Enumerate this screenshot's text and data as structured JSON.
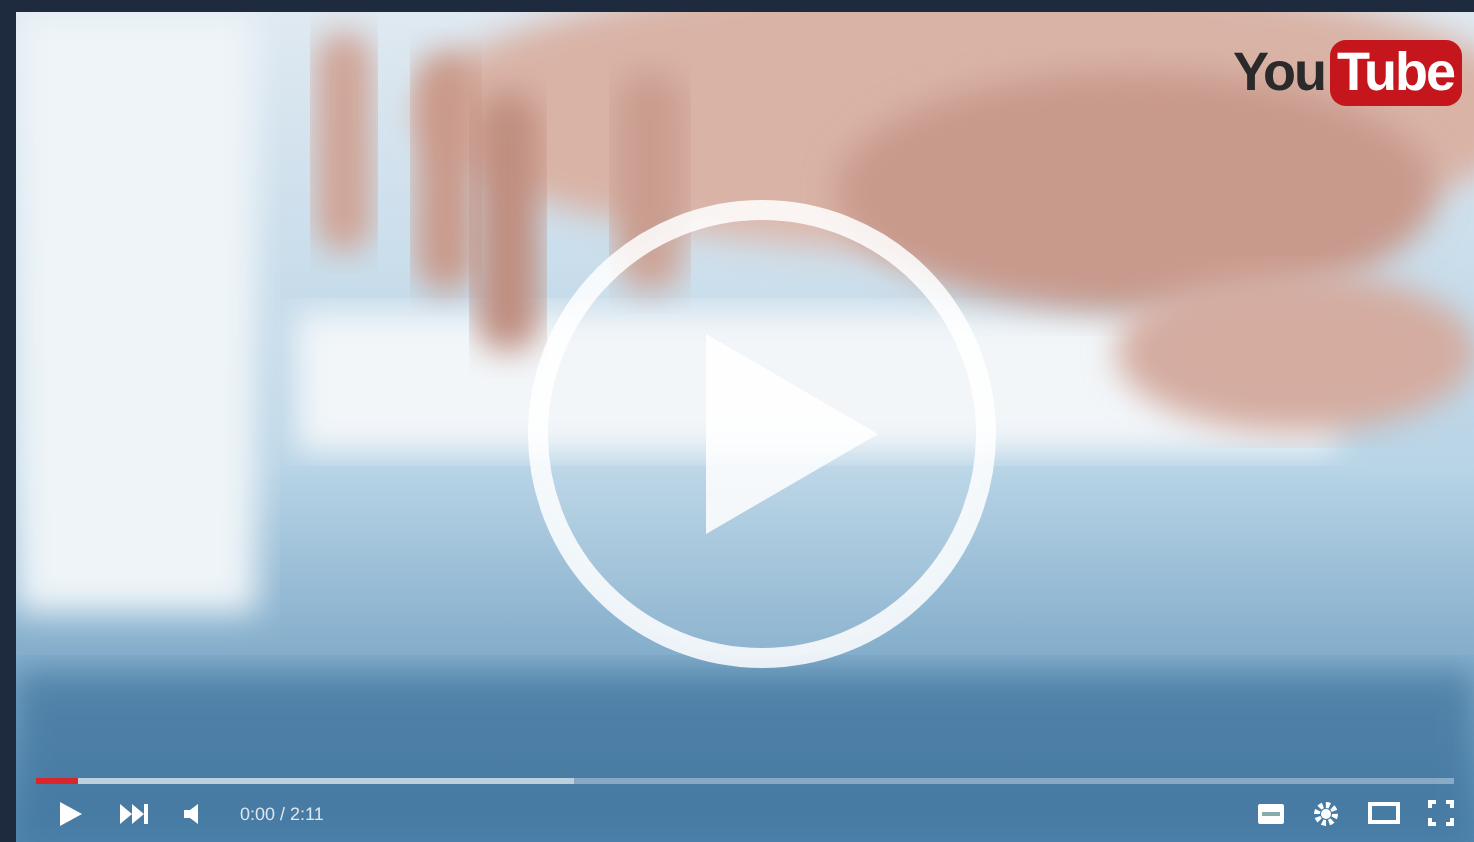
{
  "player": {
    "logo": {
      "left": "You",
      "right": "Tube"
    },
    "progress": {
      "level": 0.03
    },
    "buffer": {
      "level": 0.38
    },
    "time": "0:00 / 2:11"
  }
}
